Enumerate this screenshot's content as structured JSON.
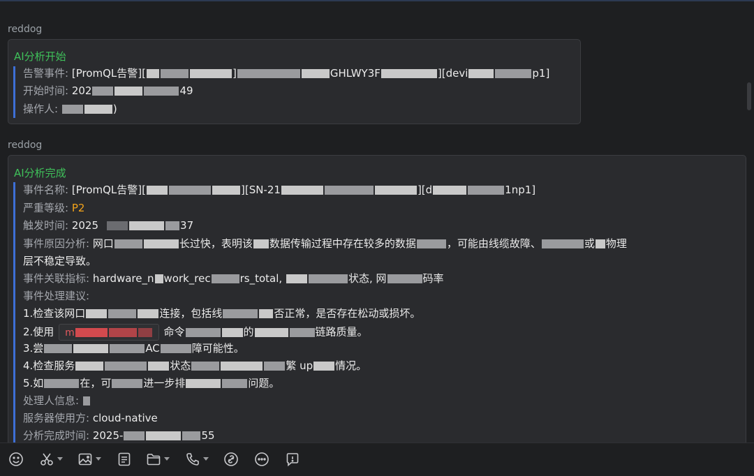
{
  "messages": [
    {
      "sender": "reddog",
      "title": "AI分析开始",
      "lines": [
        {
          "key": "告警事件:",
          "value_start": "[PromQL告警][",
          "value_mid1": "]",
          "value_mid2": "GHLWY3F",
          "value_mid3": "][devi",
          "value_end": "p1]"
        },
        {
          "key": "开始时间:",
          "value_start": "202",
          "value_end": "49"
        },
        {
          "key": "操作人:",
          "value_end": ")"
        }
      ]
    },
    {
      "sender": "reddog",
      "title": "AI分析完成",
      "lines": {
        "event_name_key": "事件名称:",
        "event_name_v1": "[PromQL告警][",
        "event_name_v2": "][SN-21",
        "event_name_v3": "][d",
        "event_name_v4": "1np1]",
        "severity_key": "严重等级:",
        "severity_value": "P2",
        "trigger_key": "触发时间:",
        "trigger_v1": "2025",
        "trigger_v2": "37",
        "cause_key": "事件原因分析:",
        "cause_v1": "网口",
        "cause_v2": "长过快，表明该",
        "cause_v3": "数据传输过程中存在较多的数据",
        "cause_v4": "，可能由线缆故障、",
        "cause_v5": "或",
        "cause_v6": "物理",
        "cause_line2": "层不稳定导致。",
        "metric_key": "事件关联指标:",
        "metric_v1": "hardware_n",
        "metric_v2": "work_rec",
        "metric_v3": "rs_total, ",
        "metric_v4": "状态, 网",
        "metric_v5": "码率",
        "advice_key": "事件处理建议:",
        "advice1_v1": "1.检查该网口",
        "advice1_v2": "连接，包括线",
        "advice1_v3": "否正常，是否存在松动或损坏。",
        "advice2_v1": "2.使用",
        "advice2_code": "m",
        "advice2_v2": "命令",
        "advice2_v3": "的",
        "advice2_v4": "链路质量。",
        "advice3_v1": "3.尝",
        "advice3_v2": "AC",
        "advice3_v3": "障可能性。",
        "advice4_v1": "4.检查服务",
        "advice4_v2": "状态",
        "advice4_v3": "繁",
        "advice4_v4": "up",
        "advice4_v5": "情况。",
        "advice5_v1": "5.如",
        "advice5_v2": "在，可",
        "advice5_v3": "进一步排",
        "advice5_v4": "问题。",
        "handler_key": "处理人信息:",
        "owner_key": "服务器使用方:",
        "owner_value": "cloud-native",
        "done_key": "分析完成时间:",
        "done_v1": "2025-",
        "done_v2": "55"
      }
    }
  ],
  "toolbar": {
    "icons": [
      "emoji-icon",
      "scissors-icon",
      "image-icon",
      "document-icon",
      "folder-icon",
      "phone-icon",
      "link-icon",
      "more-icon",
      "feedback-icon"
    ]
  },
  "colors": {
    "background": "#1e1f21",
    "card": "#2a2b2e",
    "title_green": "#3fc15a",
    "quote_blue": "#3d6fd6",
    "severity_orange": "#f3a31a"
  }
}
